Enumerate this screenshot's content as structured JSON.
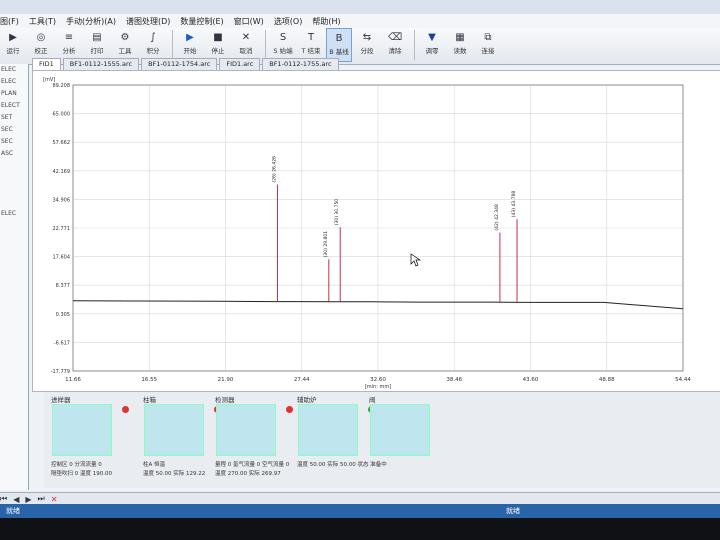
{
  "menu": [
    "图(F)",
    "工具(T)",
    "手动(分析)(A)",
    "谱图处理(D)",
    "数量控制(E)",
    "窗口(W)",
    "选项(O)",
    "帮助(H)"
  ],
  "toolbar": [
    {
      "label": "运行",
      "icon": "run-icon"
    },
    {
      "label": "校正",
      "icon": "calibrate-icon"
    },
    {
      "label": "分析",
      "icon": "analyze-icon"
    },
    {
      "label": "打印",
      "icon": "print-icon"
    },
    {
      "label": "工具",
      "icon": "tools-icon"
    },
    {
      "label": "积分",
      "icon": "integrate-icon"
    },
    {
      "label": "开始",
      "icon": "play-icon"
    },
    {
      "label": "停止",
      "icon": "stop-icon"
    },
    {
      "label": "取消",
      "icon": "cancel-icon"
    },
    {
      "label": "S 始端",
      "icon": "s-icon"
    },
    {
      "label": "T 结束",
      "icon": "t-icon"
    },
    {
      "label": "B 基线",
      "icon": "b-icon"
    },
    {
      "label": "分段",
      "icon": "segment-icon"
    },
    {
      "label": "清除",
      "icon": "clear-icon"
    },
    {
      "label": "调零",
      "icon": "zero-icon"
    },
    {
      "label": "读数",
      "icon": "read-icon"
    },
    {
      "label": "连接",
      "icon": "connect-icon"
    }
  ],
  "left_items": [
    "ELEC",
    "ELEC",
    "PLAN",
    "ELECT",
    "SET",
    "SEC",
    "SEC",
    "ASC",
    "",
    "",
    "",
    "",
    "ELEC"
  ],
  "tabs": [
    "FID1",
    "BF1-0112-1555.arc",
    "BF1-0112-1754.arc",
    "FID1.arc",
    "BF1-0112-1755.arc"
  ],
  "chart_data": {
    "type": "line",
    "xlabel": "[min: mm]",
    "ylabel": "[mV]",
    "xticks": [
      "11.66",
      "16.55",
      "21.90",
      "27.44",
      "32.60",
      "38.46",
      "43.60",
      "48.88",
      "54.44"
    ],
    "yticks": [
      "89.208",
      "65.000",
      "57.662",
      "42.169",
      "34.906",
      "22.771",
      "17.604",
      "8.377",
      "0.305",
      "-6.617",
      "-17.779"
    ],
    "x": [
      11.66,
      16.55,
      21.9,
      25.8,
      27.44,
      30.0,
      32.6,
      36.0,
      38.46,
      41.0,
      43.6,
      48.88,
      54.44
    ],
    "y": [
      8.5,
      8.4,
      8.3,
      8.2,
      8.2,
      8.1,
      8.1,
      8.0,
      8.0,
      8.0,
      7.9,
      7.9,
      5.5
    ],
    "peaks": [
      {
        "x": 26.0,
        "y": 52.0,
        "label": "(26) 26.426"
      },
      {
        "x": 29.6,
        "y": 24.0,
        "label": "(30) 29.801"
      },
      {
        "x": 30.4,
        "y": 36.0,
        "label": "(30) 30.750"
      },
      {
        "x": 41.6,
        "y": 34.0,
        "label": "(42) 42.348"
      },
      {
        "x": 42.8,
        "y": 39.0,
        "label": "(43) 43.788"
      }
    ],
    "grid": true
  },
  "panels": [
    {
      "title": "进样器",
      "lines": [
        "控制区 0   分流流量 0",
        "隔垫吹扫 0   温度 190.00"
      ],
      "led": "red"
    },
    {
      "title": "柱箱",
      "lines": [
        "柱A 恒温",
        "温度 50.00   实际 129.22"
      ],
      "led": "red"
    },
    {
      "title": "检测器",
      "lines": [
        "量程 0   氢气流量 0   空气流量 0",
        "温度 270.00   实际 269.97"
      ],
      "led": "red"
    },
    {
      "title": "辅助炉",
      "lines": [
        "温度 50.00   实际 50.00   状态 准备中"
      ],
      "led": "green"
    },
    {
      "title": "阀",
      "lines": [],
      "led": ""
    }
  ],
  "statusbar": {
    "left": "就绪",
    "center": "就绪"
  }
}
